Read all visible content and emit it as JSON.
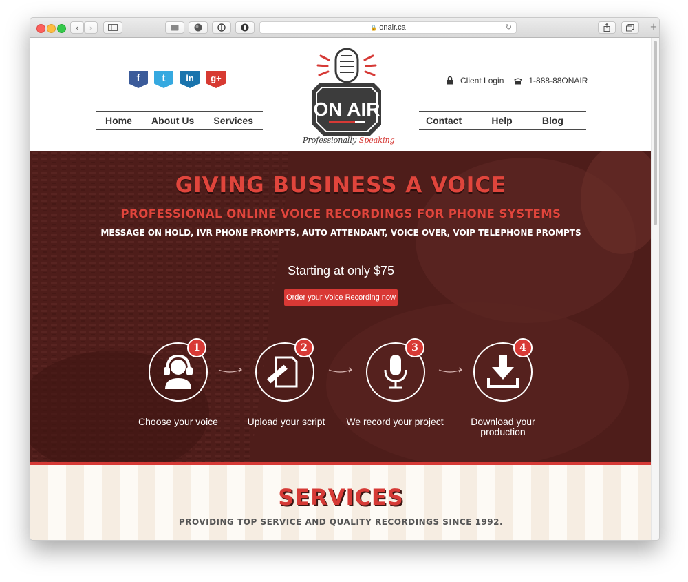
{
  "browser": {
    "url": "onair.ca",
    "title_bar_colors": {
      "close": "#fc605c",
      "minimize": "#fdbc40",
      "zoom": "#34c84a"
    }
  },
  "header": {
    "social": [
      {
        "name": "facebook",
        "glyph": "f",
        "color": "#3b5b9a"
      },
      {
        "name": "twitter",
        "glyph": "t",
        "color": "#36a9e0"
      },
      {
        "name": "linkedin",
        "glyph": "in",
        "color": "#1a74ad"
      },
      {
        "name": "google-plus",
        "glyph": "g+",
        "color": "#d73a32"
      }
    ],
    "nav_left": [
      "Home",
      "About Us",
      "Services"
    ],
    "nav_right": [
      "Contact",
      "Help",
      "Blog"
    ],
    "client_login": "Client Login",
    "phone": "1-888-88ONAIR",
    "logo": {
      "text": "ON AIR",
      "tagline_a": "Professionally",
      "tagline_b": "Speaking",
      "accent": "#d63a36"
    }
  },
  "hero": {
    "headline": "GIVING BUSINESS A VOICE",
    "subheadline": "PROFESSIONAL ONLINE VOICE RECORDINGS FOR PHONE SYSTEMS",
    "services_line": "MESSAGE ON HOLD, IVR PHONE PROMPTS, AUTO ATTENDANT, VOICE OVER, VOIP TELEPHONE PROMPTS",
    "price_text": "Starting at only $75",
    "cta_label": "Order your Voice Recording now",
    "steps": [
      {
        "number": "1",
        "label": "Choose your voice",
        "icon": "headset-person-icon"
      },
      {
        "number": "2",
        "label": "Upload your script",
        "icon": "script-pen-icon"
      },
      {
        "number": "3",
        "label": "We record your project",
        "icon": "microphone-icon"
      },
      {
        "number": "4",
        "label": "Download your production",
        "icon": "download-icon"
      }
    ]
  },
  "services": {
    "title": "SERVICES",
    "tagline": "PROVIDING TOP SERVICE AND QUALITY RECORDINGS SINCE 1992."
  }
}
